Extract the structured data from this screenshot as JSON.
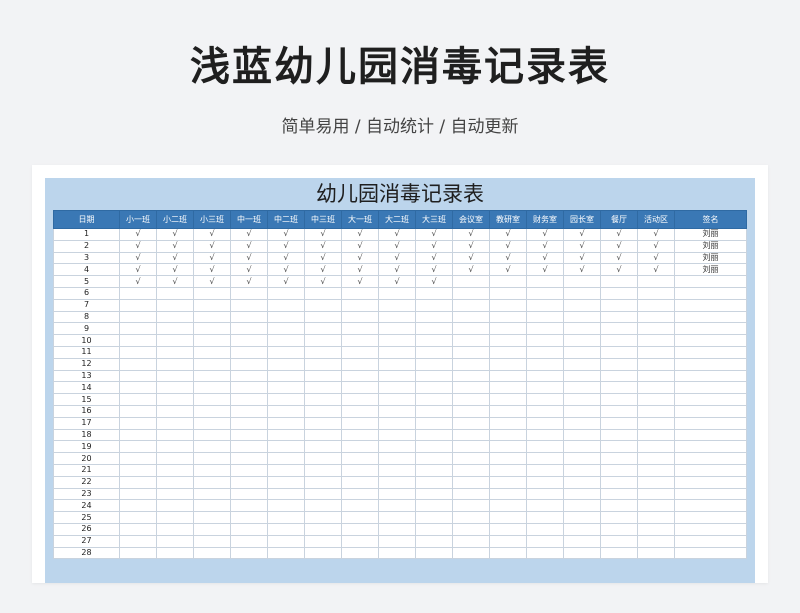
{
  "page": {
    "title": "浅蓝幼儿园消毒记录表",
    "subtitle": "简单易用 / 自动统计 / 自动更新"
  },
  "sheet": {
    "title": "幼儿园消毒记录表",
    "headers": [
      "日期",
      "小一班",
      "小二班",
      "小三班",
      "中一班",
      "中二班",
      "中三班",
      "大一班",
      "大二班",
      "大三班",
      "会议室",
      "教研室",
      "财务室",
      "园长室",
      "餐厅",
      "活动区",
      "签名"
    ],
    "rows": [
      [
        "1",
        "√",
        "√",
        "√",
        "√",
        "√",
        "√",
        "√",
        "√",
        "√",
        "√",
        "√",
        "√",
        "√",
        "√",
        "√",
        "刘丽"
      ],
      [
        "2",
        "√",
        "√",
        "√",
        "√",
        "√",
        "√",
        "√",
        "√",
        "√",
        "√",
        "√",
        "√",
        "√",
        "√",
        "√",
        "刘丽"
      ],
      [
        "3",
        "√",
        "√",
        "√",
        "√",
        "√",
        "√",
        "√",
        "√",
        "√",
        "√",
        "√",
        "√",
        "√",
        "√",
        "√",
        "刘丽"
      ],
      [
        "4",
        "√",
        "√",
        "√",
        "√",
        "√",
        "√",
        "√",
        "√",
        "√",
        "√",
        "√",
        "√",
        "√",
        "√",
        "√",
        "刘丽"
      ],
      [
        "5",
        "√",
        "√",
        "√",
        "√",
        "√",
        "√",
        "√",
        "√",
        "√",
        "",
        "",
        "",
        "",
        "",
        "",
        ""
      ],
      [
        "6",
        "",
        "",
        "",
        "",
        "",
        "",
        "",
        "",
        "",
        "",
        "",
        "",
        "",
        "",
        "",
        ""
      ],
      [
        "7",
        "",
        "",
        "",
        "",
        "",
        "",
        "",
        "",
        "",
        "",
        "",
        "",
        "",
        "",
        "",
        ""
      ],
      [
        "8",
        "",
        "",
        "",
        "",
        "",
        "",
        "",
        "",
        "",
        "",
        "",
        "",
        "",
        "",
        "",
        ""
      ],
      [
        "9",
        "",
        "",
        "",
        "",
        "",
        "",
        "",
        "",
        "",
        "",
        "",
        "",
        "",
        "",
        "",
        ""
      ],
      [
        "10",
        "",
        "",
        "",
        "",
        "",
        "",
        "",
        "",
        "",
        "",
        "",
        "",
        "",
        "",
        "",
        ""
      ],
      [
        "11",
        "",
        "",
        "",
        "",
        "",
        "",
        "",
        "",
        "",
        "",
        "",
        "",
        "",
        "",
        "",
        ""
      ],
      [
        "12",
        "",
        "",
        "",
        "",
        "",
        "",
        "",
        "",
        "",
        "",
        "",
        "",
        "",
        "",
        "",
        ""
      ],
      [
        "13",
        "",
        "",
        "",
        "",
        "",
        "",
        "",
        "",
        "",
        "",
        "",
        "",
        "",
        "",
        "",
        ""
      ],
      [
        "14",
        "",
        "",
        "",
        "",
        "",
        "",
        "",
        "",
        "",
        "",
        "",
        "",
        "",
        "",
        "",
        ""
      ],
      [
        "15",
        "",
        "",
        "",
        "",
        "",
        "",
        "",
        "",
        "",
        "",
        "",
        "",
        "",
        "",
        "",
        ""
      ],
      [
        "16",
        "",
        "",
        "",
        "",
        "",
        "",
        "",
        "",
        "",
        "",
        "",
        "",
        "",
        "",
        "",
        ""
      ],
      [
        "17",
        "",
        "",
        "",
        "",
        "",
        "",
        "",
        "",
        "",
        "",
        "",
        "",
        "",
        "",
        "",
        ""
      ],
      [
        "18",
        "",
        "",
        "",
        "",
        "",
        "",
        "",
        "",
        "",
        "",
        "",
        "",
        "",
        "",
        "",
        ""
      ],
      [
        "19",
        "",
        "",
        "",
        "",
        "",
        "",
        "",
        "",
        "",
        "",
        "",
        "",
        "",
        "",
        "",
        ""
      ],
      [
        "20",
        "",
        "",
        "",
        "",
        "",
        "",
        "",
        "",
        "",
        "",
        "",
        "",
        "",
        "",
        "",
        ""
      ],
      [
        "21",
        "",
        "",
        "",
        "",
        "",
        "",
        "",
        "",
        "",
        "",
        "",
        "",
        "",
        "",
        "",
        ""
      ],
      [
        "22",
        "",
        "",
        "",
        "",
        "",
        "",
        "",
        "",
        "",
        "",
        "",
        "",
        "",
        "",
        "",
        ""
      ],
      [
        "23",
        "",
        "",
        "",
        "",
        "",
        "",
        "",
        "",
        "",
        "",
        "",
        "",
        "",
        "",
        "",
        ""
      ],
      [
        "24",
        "",
        "",
        "",
        "",
        "",
        "",
        "",
        "",
        "",
        "",
        "",
        "",
        "",
        "",
        "",
        ""
      ],
      [
        "25",
        "",
        "",
        "",
        "",
        "",
        "",
        "",
        "",
        "",
        "",
        "",
        "",
        "",
        "",
        "",
        ""
      ],
      [
        "26",
        "",
        "",
        "",
        "",
        "",
        "",
        "",
        "",
        "",
        "",
        "",
        "",
        "",
        "",
        "",
        ""
      ],
      [
        "27",
        "",
        "",
        "",
        "",
        "",
        "",
        "",
        "",
        "",
        "",
        "",
        "",
        "",
        "",
        "",
        ""
      ],
      [
        "28",
        "",
        "",
        "",
        "",
        "",
        "",
        "",
        "",
        "",
        "",
        "",
        "",
        "",
        "",
        "",
        ""
      ]
    ]
  }
}
